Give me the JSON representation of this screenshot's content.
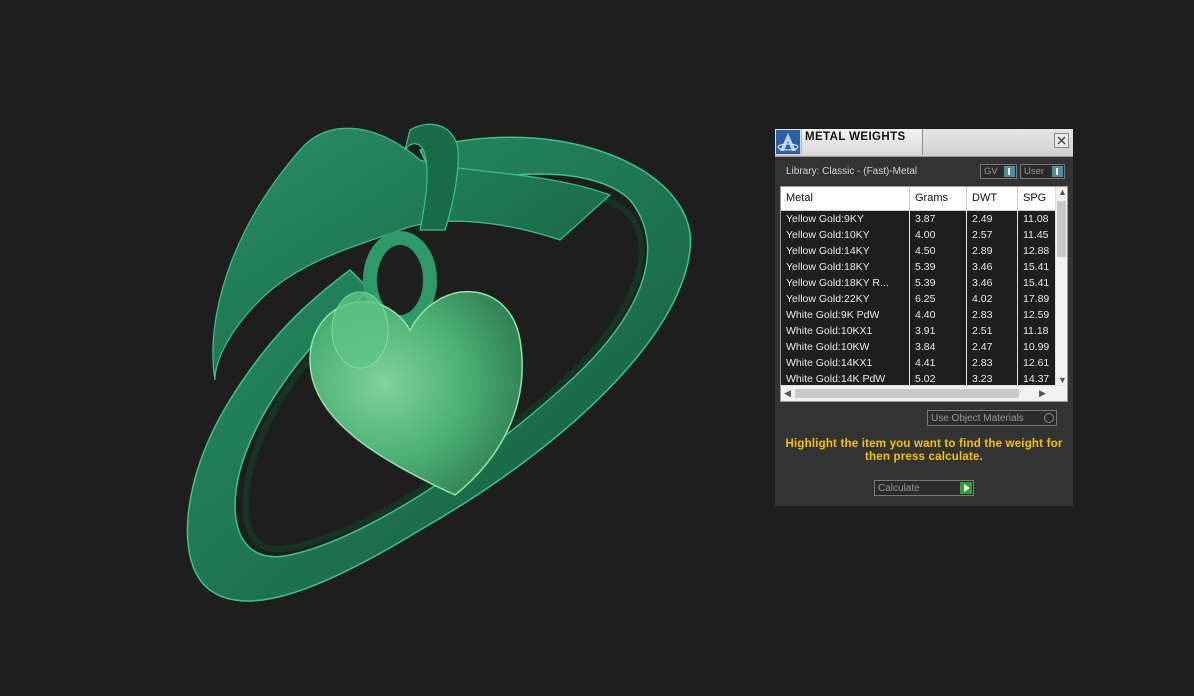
{
  "viewport": {
    "object": "ring-with-heart-charm-3d-model",
    "colors": {
      "ring": "#1f7a55",
      "charm": "#4bb37a",
      "background": "#1f1e1e"
    }
  },
  "panel": {
    "title": "METAL WEIGHTS",
    "library_label": "Library: Classic - (Fast)-Metal",
    "gv_label": "GV",
    "user_label": "User",
    "columns": [
      "Metal",
      "Grams",
      "DWT",
      "SPG"
    ],
    "rows": [
      {
        "metal": "Yellow Gold:9KY",
        "grams": "3.87",
        "dwt": "2.49",
        "spg": "11.08"
      },
      {
        "metal": "Yellow Gold:10KY",
        "grams": "4.00",
        "dwt": "2.57",
        "spg": "11.45"
      },
      {
        "metal": "Yellow Gold:14KY",
        "grams": "4.50",
        "dwt": "2.89",
        "spg": "12.88"
      },
      {
        "metal": "Yellow Gold:18KY",
        "grams": "5.39",
        "dwt": "3.46",
        "spg": "15.41"
      },
      {
        "metal": "Yellow Gold:18KY R...",
        "grams": "5.39",
        "dwt": "3.46",
        "spg": "15.41"
      },
      {
        "metal": "Yellow Gold:22KY",
        "grams": "6.25",
        "dwt": "4.02",
        "spg": "17.89"
      },
      {
        "metal": "White Gold:9K PdW",
        "grams": "4.40",
        "dwt": "2.83",
        "spg": "12.59"
      },
      {
        "metal": "White Gold:10KX1",
        "grams": "3.91",
        "dwt": "2.51",
        "spg": "11.18"
      },
      {
        "metal": "White Gold:10KW",
        "grams": "3.84",
        "dwt": "2.47",
        "spg": "10.99"
      },
      {
        "metal": "White Gold:14KX1",
        "grams": "4.41",
        "dwt": "2.83",
        "spg": "12.61"
      },
      {
        "metal": "White Gold:14K PdW",
        "grams": "5.02",
        "dwt": "3.23",
        "spg": "14.37"
      }
    ],
    "material_dropdown": "Use Object Materials",
    "hint": "Highlight the item you want to find the weight for then press calculate.",
    "calculate_label": "Calculate"
  }
}
